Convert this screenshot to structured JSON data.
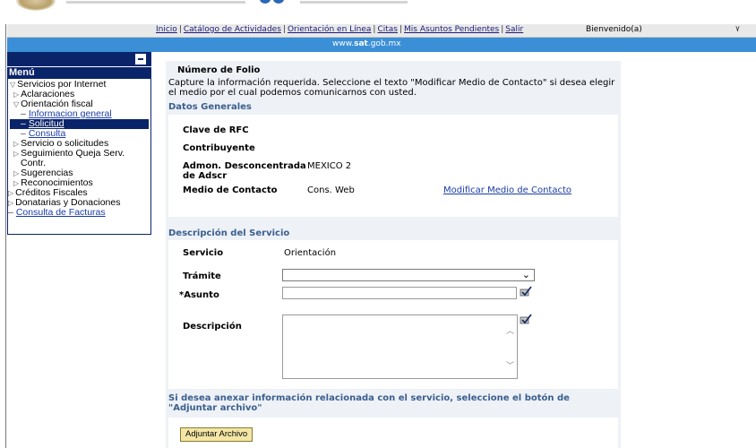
{
  "nav": {
    "links": [
      "Inicio",
      "Catálogo de Actividades",
      "Orientación en Línea",
      "Citas",
      "Mis Asuntos Pendientes",
      "Salir"
    ],
    "welcome": "Bienvenido(a)",
    "welcome_suffix": "۷"
  },
  "band": {
    "prefix": "www.",
    "brand": "sat",
    "suffix": ".gob.mx"
  },
  "sidebar": {
    "title": "Menú",
    "items": [
      {
        "label": "Servicios por Internet"
      },
      {
        "label": "Aclaraciones"
      },
      {
        "label": "Orientación fiscal"
      },
      {
        "label": "Informacion general"
      },
      {
        "label": "Solicitud"
      },
      {
        "label": "Consulta"
      },
      {
        "label": "Servicio o solicitudes"
      },
      {
        "label": "Seguimiento Queja Serv."
      },
      {
        "label": "Contr."
      },
      {
        "label": "Sugerencias"
      },
      {
        "label": "Reconocimientos"
      },
      {
        "label": "Créditos Fiscales"
      },
      {
        "label": "Donatarias y Donaciones"
      },
      {
        "label": "Consulta de Facturas"
      }
    ]
  },
  "main": {
    "folio_label": "Número de Folio",
    "instructions": "Capture la información requerida. Seleccione el texto \"Modificar Medio de Contacto\" si desea elegir el medio por el cual podemos comunicarnos con usted.",
    "datos_title": "Datos Generales",
    "rfc_label": "Clave de RFC",
    "contribuyente_label": "Contribuyente",
    "admon_label_1": "Admon. Desconcentrada",
    "admon_label_2": "de Adscr",
    "admon_value": "MEXICO 2",
    "medio_label": "Medio de Contacto",
    "medio_value": "Cons. Web",
    "modificar_link": "Modificar Medio de Contacto",
    "desc_title": "Descripción del Servicio",
    "servicio_label": "Servicio",
    "servicio_value": "Orientación",
    "tramite_label": "Trámite",
    "tramite_value": "",
    "asunto_label": "*Asunto",
    "asunto_value": "",
    "descripcion_label": "Descripción",
    "descripcion_value": "",
    "attach_note": "Si desea anexar información relacionada con el servicio, seleccione el botón de \"Adjuntar archivo\"",
    "attach_button": "Adjuntar Archivo"
  }
}
